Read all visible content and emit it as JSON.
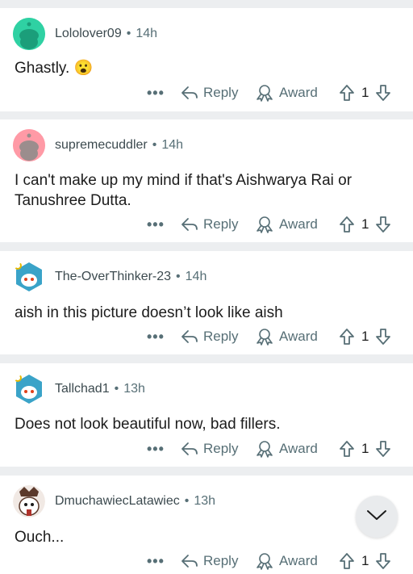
{
  "comments": [
    {
      "username": "Lololover09",
      "time": "14h",
      "text": "Ghastly. 😮",
      "avatar": "snoo-teal-avatar",
      "avatar_color": "#2fd1a3"
    },
    {
      "username": "supremecuddler",
      "time": "14h",
      "text": "I can't make up my mind if that's Aishwarya Rai or Tanushree Dutta.",
      "avatar": "snoo-pink-avatar",
      "avatar_color": "#ff9aa6"
    },
    {
      "username": "The-OverThinker-23",
      "time": "14h",
      "text": "aish in this picture doesn’t look like aish",
      "avatar": "snoo-hexagon-avatar",
      "avatar_color": "#3aa3c8"
    },
    {
      "username": "Tallchad1",
      "time": "13h",
      "text": "Does not look beautiful now, bad fillers.",
      "avatar": "snoo-hexagon-avatar",
      "avatar_color": "#3aa3c8"
    },
    {
      "username": "DmuchawiecLatawiec",
      "time": "13h",
      "text": "Ouch...",
      "avatar": "snoo-custom-avatar",
      "avatar_color": "#5b3a2c"
    }
  ],
  "actions": {
    "more": "•••",
    "reply": "Reply",
    "award": "Award",
    "vote_count": "1"
  },
  "dot": "•",
  "scroll_button": "chevron-down-icon"
}
